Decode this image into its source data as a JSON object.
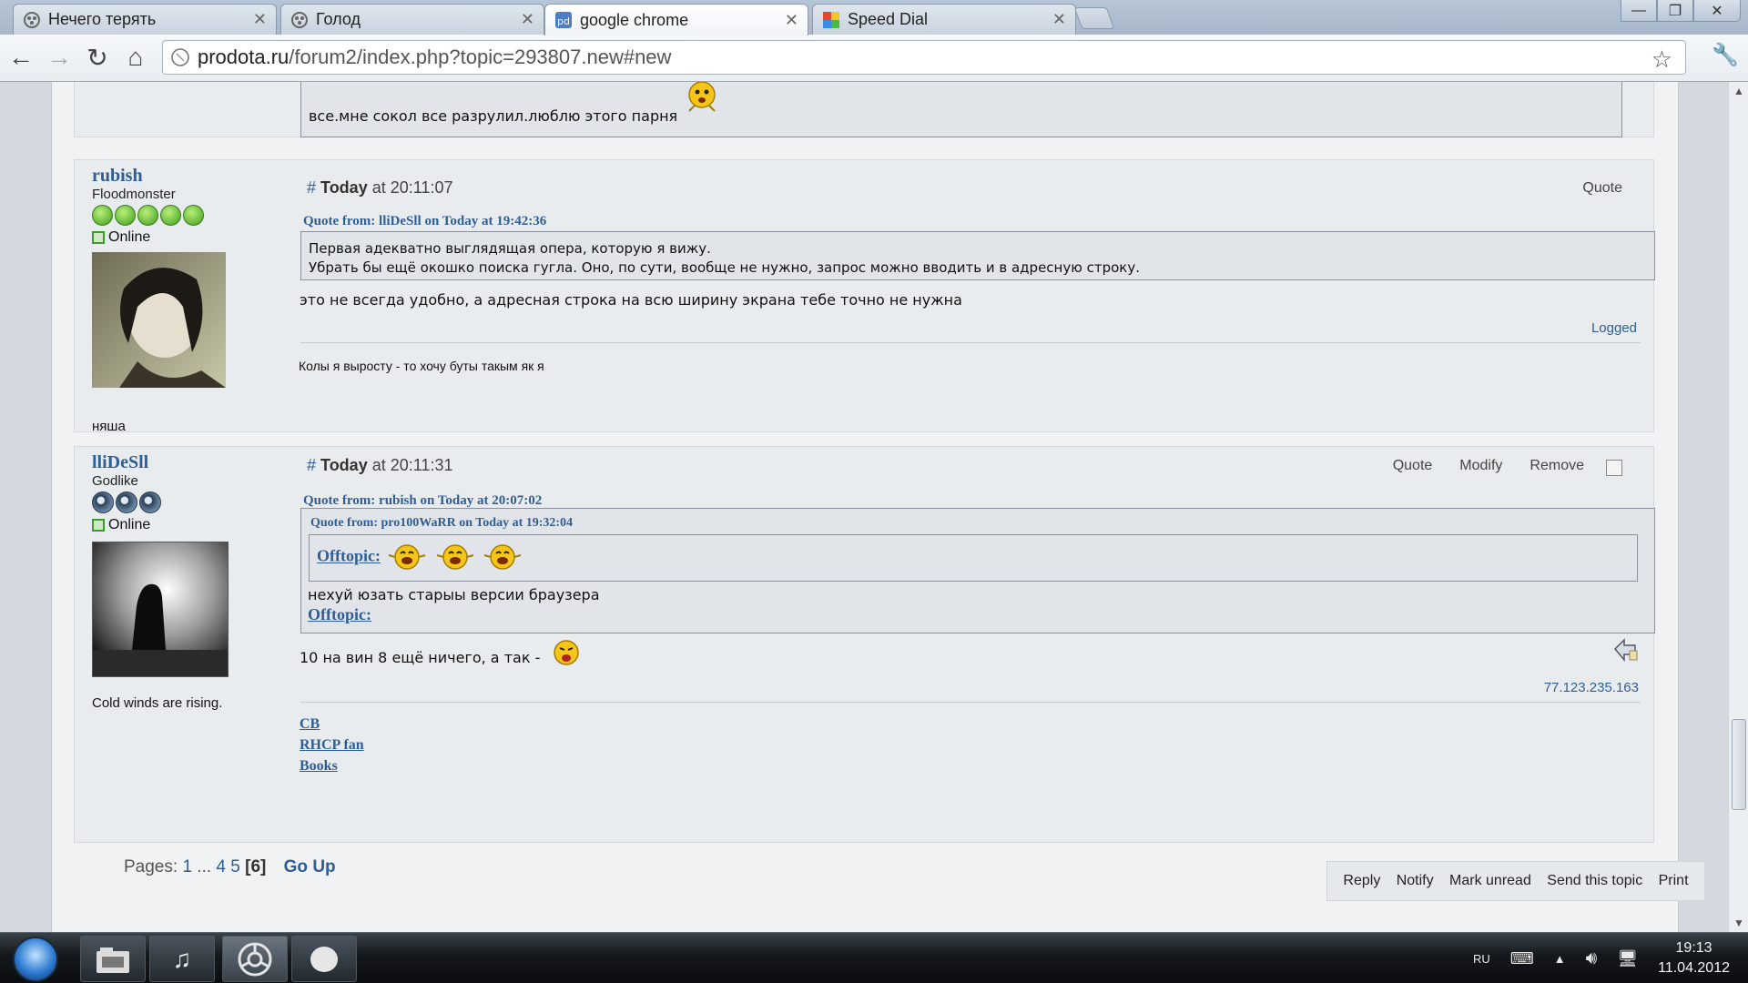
{
  "browser": {
    "tabs": [
      {
        "title": "Нечего терять",
        "icon": "forum-favicon-icon",
        "active": false
      },
      {
        "title": "Голод",
        "icon": "forum-favicon-icon",
        "active": false
      },
      {
        "title": "google chrome",
        "icon": "page-favicon-icon",
        "active": true
      },
      {
        "title": "Speed Dial",
        "icon": "speed-dial-icon",
        "active": false
      }
    ],
    "url_host": "prodota.ru",
    "url_path": "/forum2/index.php?topic=293807.new#new"
  },
  "prev_post": {
    "text": "все.мне сокол все разрулил.люблю этого парня"
  },
  "posts": [
    {
      "author": "rubish",
      "rank": "Floodmonster",
      "status": "Online",
      "personal_text": "няша",
      "header_prefix": "Today",
      "header_time": "at 20:11:07",
      "actions": [
        "Quote"
      ],
      "quote_from": "Quote from: lliDeSll on Today at 19:42:36",
      "quote_lines": [
        "Первая адекватно выглядящая опера, которую я вижу.",
        "Убрать бы ещё окошко поиска гугла. Оно, по сути, вообще не нужно, запрос можно вводить и в адресную строку."
      ],
      "body": "это не всегда удобно, а адресная строка на всю ширину экрана тебе точно не нужна",
      "logged": "Logged",
      "signature": "Колы я выросту - то хочу буты такым як я"
    },
    {
      "author": "lliDeSll",
      "rank": "Godlike",
      "status": "Online",
      "personal_text": "Cold winds are rising.",
      "header_prefix": "Today",
      "header_time": "at 20:11:31",
      "actions": [
        "Quote",
        "Modify",
        "Remove"
      ],
      "quote_from": "Quote from: rubish on Today at 20:07:02",
      "nested_quote_from": "Quote from: pro100WaRR on Today at 19:32:04",
      "nested_offtopic": "Offtopic:",
      "quote_text": "нехуй юзать старыы версии браузера",
      "quote_offtopic": "Offtopic:",
      "body": "10 на вин 8 ещё ничего, а так -",
      "ip": "77.123.235.163",
      "sig_links": [
        "CB",
        "RHCP fan",
        "Books"
      ]
    }
  ],
  "pagination": {
    "label": "Pages:",
    "pages": [
      "1",
      "...",
      "4",
      "5"
    ],
    "current": "[6]",
    "go_up": "Go Up"
  },
  "bottom_actions": [
    "Reply",
    "Notify",
    "Mark unread",
    "Send this topic",
    "Print"
  ],
  "taskbar": {
    "lang": "RU",
    "time": "19:13",
    "date": "11.04.2012"
  }
}
